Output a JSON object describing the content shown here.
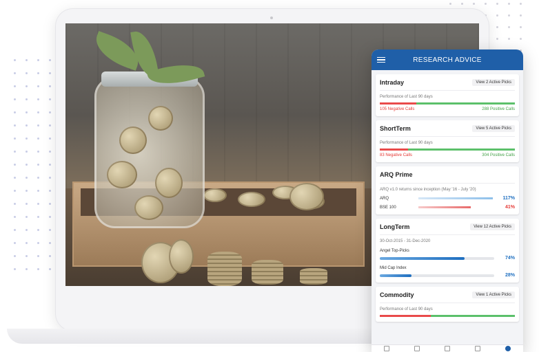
{
  "app": {
    "title": "RESEARCH ADVICE"
  },
  "colors": {
    "accent": "#1f5fa8",
    "negative": "#e53935",
    "positive": "#43a047",
    "link_blue": "#1f6fc0"
  },
  "cards": {
    "intraday": {
      "title": "Intraday",
      "button": "View 2 Active Picks",
      "subtitle": "Performance of Last 90 days",
      "negative": "105 Negative Calls",
      "positive": "288 Positive Calls",
      "negative_share": 0.27
    },
    "shortterm": {
      "title": "ShortTerm",
      "button": "View 5 Active Picks",
      "subtitle": "Performance of Last 90 days",
      "negative": "83 Negative Calls",
      "positive": "304 Positive Calls",
      "negative_share": 0.21
    },
    "arq": {
      "title": "ARQ Prime",
      "subtitle": "ARQ v1.0 returns since inception (May '16 - July '20)",
      "rows": [
        {
          "label": "ARQ",
          "value": "117%"
        },
        {
          "label": "BSE 100",
          "value": "41%"
        }
      ]
    },
    "longterm": {
      "title": "LongTerm",
      "button": "View 12 Active Picks",
      "subtitle": "30-Oct-2015 - 31-Dec-2020",
      "rows": [
        {
          "label": "Angel Top-Picks",
          "value": "74%",
          "level": 0.74
        },
        {
          "label": "Mid Cap Index",
          "value": "28%",
          "level": 0.28
        }
      ]
    },
    "commodity": {
      "title": "Commodity",
      "button": "View 1 Active Picks",
      "subtitle": "Performance of Last 90 days"
    }
  },
  "icons": [
    "menu-icon",
    "nav-home-icon",
    "nav-research-icon",
    "nav-calendar-icon",
    "nav-portfolio-icon",
    "nav-profile-icon"
  ]
}
